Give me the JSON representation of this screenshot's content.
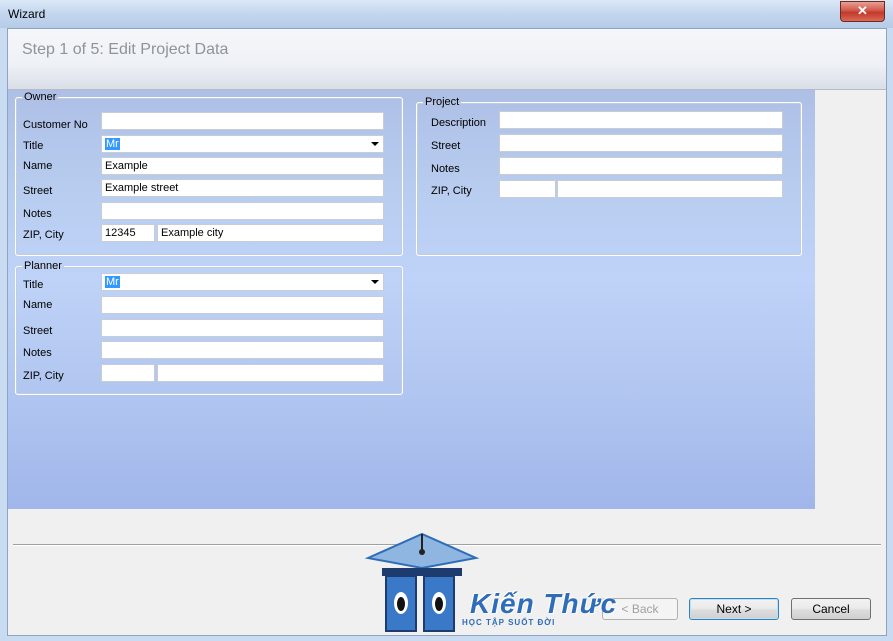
{
  "window": {
    "title": "Wizard",
    "close_label": "✕"
  },
  "header": {
    "step": "Step 1 of 5: Edit Project Data"
  },
  "owner": {
    "legend": "Owner",
    "customer_no_label": "Customer No",
    "customer_no_value": "",
    "title_label": "Title",
    "title_value": "Mr",
    "name_label": "Name",
    "name_value": "Example",
    "street_label": "Street",
    "street_value": "Example street",
    "notes_label": "Notes",
    "notes_value": "",
    "zip_city_label": "ZIP, City",
    "zip_value": "12345",
    "city_value": "Example city"
  },
  "project": {
    "legend": "Project",
    "description_label": "Description",
    "description_value": "",
    "street_label": "Street",
    "street_value": "",
    "notes_label": "Notes",
    "notes_value": "",
    "zip_city_label": "ZIP, City",
    "zip_value": "",
    "city_value": ""
  },
  "planner": {
    "legend": "Planner",
    "title_label": "Title",
    "title_value": "Mr",
    "name_label": "Name",
    "name_value": "",
    "street_label": "Street",
    "street_value": "",
    "notes_label": "Notes",
    "notes_value": "",
    "zip_city_label": "ZIP, City",
    "zip_value": "",
    "city_value": ""
  },
  "buttons": {
    "back": "< Back",
    "next": "Next >",
    "cancel": "Cancel"
  },
  "watermark": {
    "brand": "Kiến Thức",
    "tagline": "HỌC TẬP SUỐT ĐỜI"
  },
  "colors": {
    "selection": "#3399ff",
    "content_bg": "#b8cdf0",
    "brand": "#2f6db8"
  }
}
